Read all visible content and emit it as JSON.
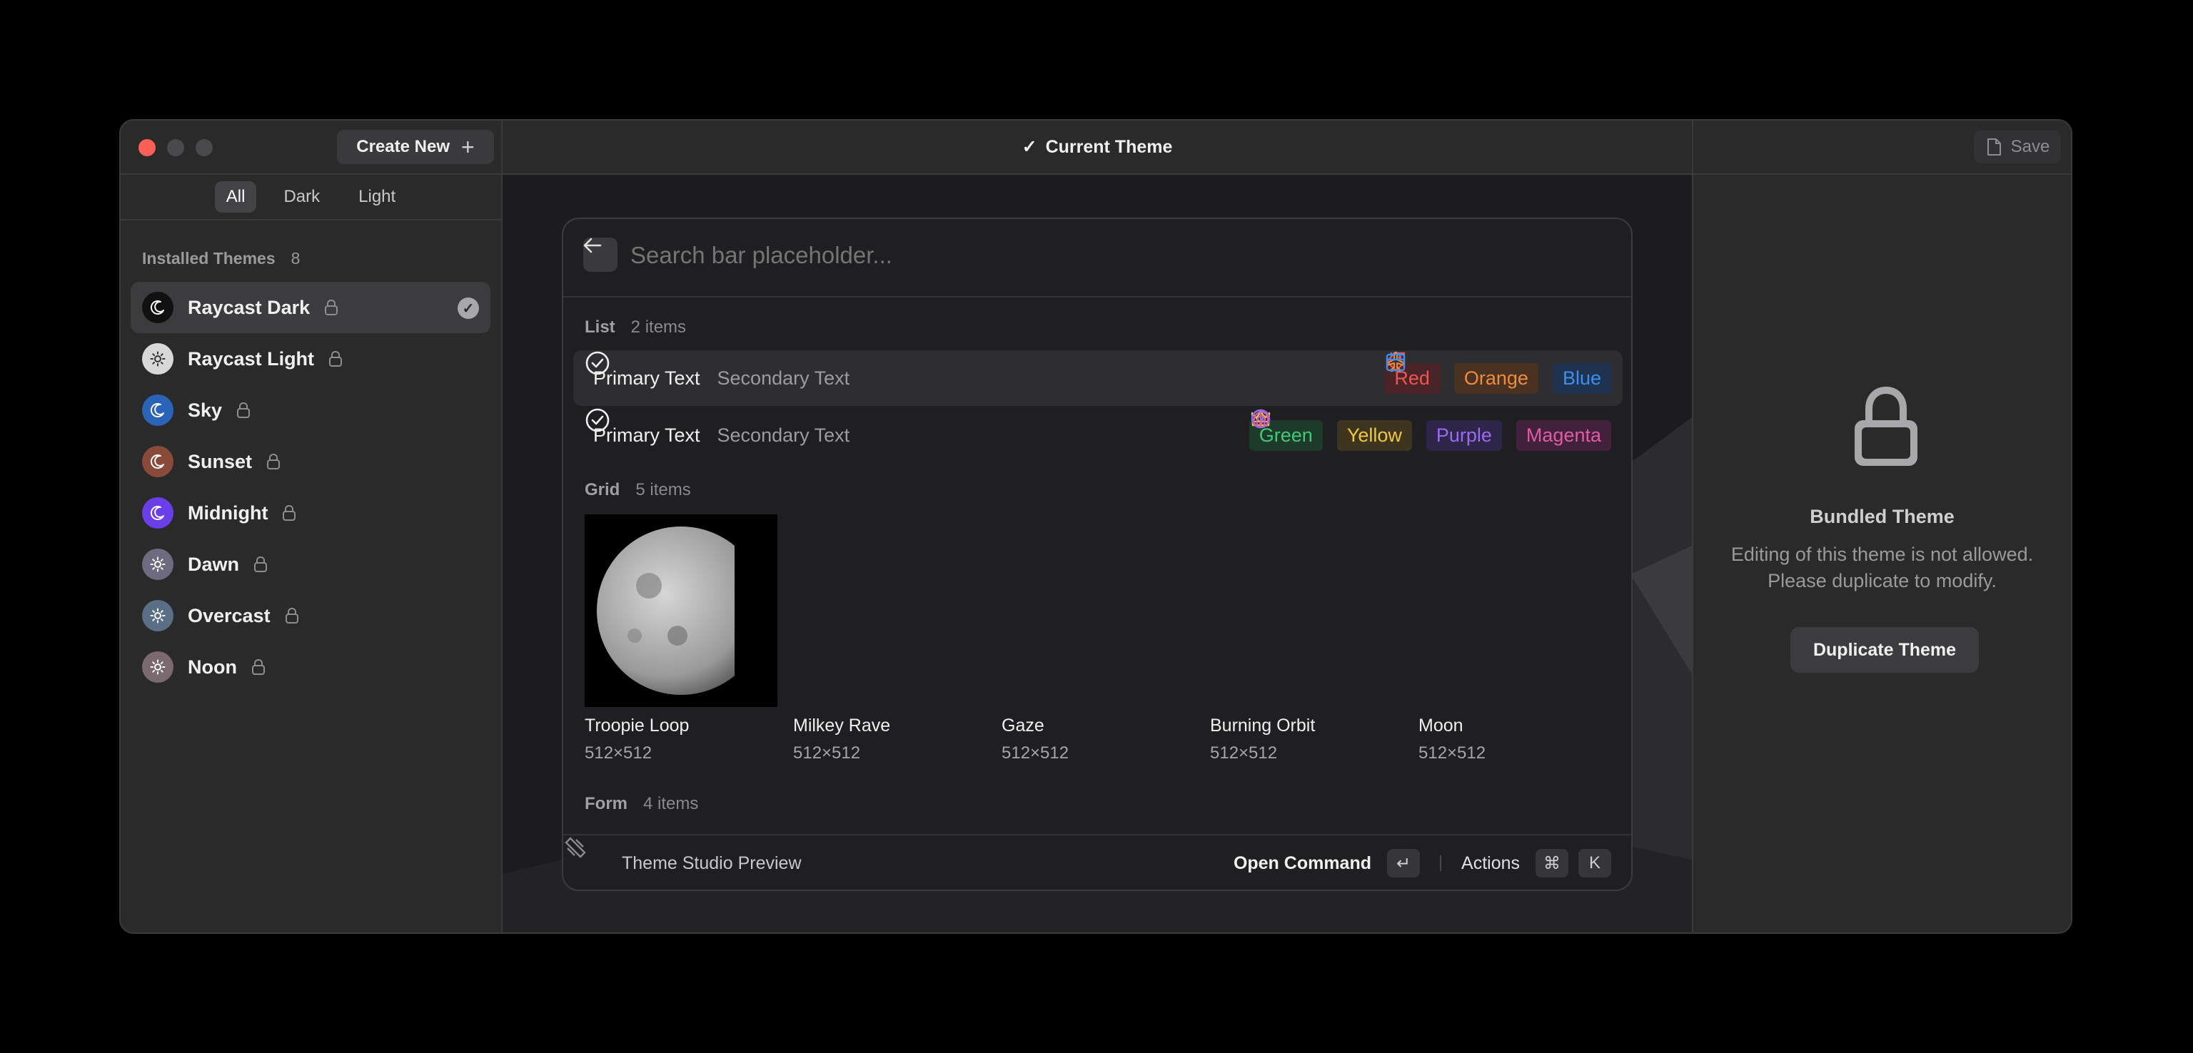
{
  "sidebar": {
    "create_new_label": "Create New",
    "filters": [
      "All",
      "Dark",
      "Light"
    ],
    "active_filter": "All",
    "section_title": "Installed Themes",
    "section_count": "8",
    "themes": [
      {
        "name": "Raycast Dark",
        "icon": "moon-icon",
        "icon_bg": "#111111",
        "selected": true
      },
      {
        "name": "Raycast Light",
        "icon": "sun-icon",
        "icon_bg": "#d8d8d8",
        "selected": false
      },
      {
        "name": "Sky",
        "icon": "moon-icon",
        "icon_bg": "#2a64b8",
        "selected": false
      },
      {
        "name": "Sunset",
        "icon": "moon-icon",
        "icon_bg": "#8a4a3a",
        "selected": false
      },
      {
        "name": "Midnight",
        "icon": "moon-icon",
        "icon_bg": "#6a3ee8",
        "selected": false
      },
      {
        "name": "Dawn",
        "icon": "sun-icon",
        "icon_bg": "#6e6a80",
        "selected": false
      },
      {
        "name": "Overcast",
        "icon": "sun-icon",
        "icon_bg": "#5a6e86",
        "selected": false
      },
      {
        "name": "Noon",
        "icon": "sun-icon",
        "icon_bg": "#7a6a70",
        "selected": false
      }
    ]
  },
  "header": {
    "title": "Current Theme",
    "check_glyph": "✓",
    "save_label": "Save"
  },
  "preview": {
    "search_placeholder": "Search bar placeholder...",
    "list_label": "List",
    "list_count": "2 items",
    "list_rows": [
      {
        "primary": "Primary Text",
        "secondary": "Secondary Text",
        "icons": [
          {
            "name": "tag-icon",
            "color": "#ee5555"
          },
          {
            "name": "airplane-icon",
            "color": "#f08a3c"
          },
          {
            "name": "calendar-icon",
            "color": "#3c8ef0"
          }
        ],
        "tags": [
          {
            "label": "Red",
            "color": "#ee5555",
            "bg": "#4a2426"
          },
          {
            "label": "Orange",
            "color": "#f08a3c",
            "bg": "#4a3222"
          },
          {
            "label": "Blue",
            "color": "#3c8ef0",
            "bg": "#1f3350"
          }
        ]
      },
      {
        "primary": "Primary Text",
        "secondary": "Secondary Text",
        "icons": [
          {
            "name": "check-circle-icon",
            "color": "#42c87a"
          },
          {
            "name": "crown-icon",
            "color": "#f0c83c"
          },
          {
            "name": "clock-icon",
            "color": "#8a6af0"
          },
          {
            "name": "fingerprint-icon",
            "color": "#e05aa8"
          }
        ],
        "tags": [
          {
            "label": "Green",
            "color": "#42c87a",
            "bg": "#1e3a2a"
          },
          {
            "label": "Yellow",
            "color": "#f0c83c",
            "bg": "#3e3520"
          },
          {
            "label": "Purple",
            "color": "#9a6af0",
            "bg": "#2e2648"
          },
          {
            "label": "Magenta",
            "color": "#e05aa8",
            "bg": "#42223a"
          }
        ]
      }
    ],
    "grid_label": "Grid",
    "grid_count": "5 items",
    "grid_items": [
      {
        "title": "Troopie Loop",
        "subtitle": "512×512"
      },
      {
        "title": "Milkey Rave",
        "subtitle": "512×512"
      },
      {
        "title": "Gaze",
        "subtitle": "512×512"
      },
      {
        "title": "Burning Orbit",
        "subtitle": "512×512"
      },
      {
        "title": "Moon",
        "subtitle": "512×512"
      }
    ],
    "form_label": "Form",
    "form_count": "4 items",
    "action_bar": {
      "title": "Theme Studio Preview",
      "primary_action": "Open Command",
      "primary_key": "↵",
      "secondary_action": "Actions",
      "keys": [
        "⌘",
        "K"
      ]
    }
  },
  "right_panel": {
    "title": "Bundled Theme",
    "description_line1": "Editing of this theme is not allowed.",
    "description_line2": "Please duplicate to modify.",
    "duplicate_label": "Duplicate Theme"
  },
  "colors": {
    "background": "#262627",
    "close_button": "#fe5f57",
    "accent_text": "#f0f0f0"
  }
}
